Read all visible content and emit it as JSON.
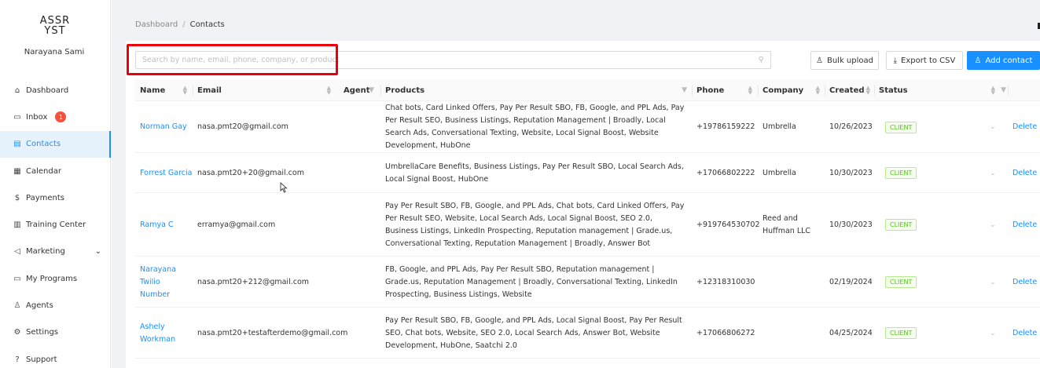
{
  "sidebar": {
    "logo_line1": "ASSR",
    "logo_line2": "YST",
    "user_name": "Narayana Sami",
    "items": [
      {
        "label": "Dashboard",
        "icon": "home-icon",
        "glyph": "⌂"
      },
      {
        "label": "Inbox",
        "icon": "inbox-icon",
        "glyph": "▭",
        "badge": "1"
      },
      {
        "label": "Contacts",
        "icon": "contacts-icon",
        "glyph": "▤"
      },
      {
        "label": "Calendar",
        "icon": "calendar-icon",
        "glyph": "▦"
      },
      {
        "label": "Payments",
        "icon": "dollar-icon",
        "glyph": "$"
      },
      {
        "label": "Training Center",
        "icon": "book-icon",
        "glyph": "▥"
      },
      {
        "label": "Marketing",
        "icon": "megaphone-icon",
        "glyph": "◁",
        "chevron": "⌄"
      },
      {
        "label": "My Programs",
        "icon": "monitor-icon",
        "glyph": "▭"
      },
      {
        "label": "Agents",
        "icon": "users-icon",
        "glyph": "♙"
      },
      {
        "label": "Settings",
        "icon": "gear-icon",
        "glyph": "⚙"
      },
      {
        "label": "Support",
        "icon": "question-icon",
        "glyph": "?"
      }
    ]
  },
  "breadcrumb": {
    "root": "Dashboard",
    "separator": "/",
    "current": "Contacts"
  },
  "search": {
    "placeholder": "Search by name, email, phone, company, or product",
    "value": ""
  },
  "toolbar": {
    "bulk_upload": "Bulk upload",
    "export_csv": "Export to CSV",
    "add_contact": "Add contact"
  },
  "table": {
    "columns": {
      "name": "Name",
      "email": "Email",
      "agent": "Agent",
      "products": "Products",
      "phone": "Phone",
      "company": "Company",
      "created": "Created",
      "status": "Status"
    },
    "rows": [
      {
        "name": "Norman Gay",
        "email": "nasa.pmt20@gmail.com",
        "agent": "",
        "products": "Chat bots, Card Linked Offers, Pay Per Result SBO, FB, Google, and PPL Ads, Pay Per Result SEO, Business Listings, Reputation Management | Broadly, Local Search Ads, Conversational Texting, Website, Local Signal Boost, Website Development, HubOne",
        "phone": "+19786159222",
        "company": "Umbrella",
        "created": "10/26/2023",
        "status": "CLIENT",
        "action": "Delete"
      },
      {
        "name": "Forrest Garcia",
        "email": "nasa.pmt20+20@gmail.com",
        "agent": "",
        "products": "UmbrellaCare Benefits, Business Listings, Pay Per Result SBO, Local Search Ads, Local Signal Boost, HubOne",
        "phone": "+17066802222",
        "company": "Umbrella",
        "created": "10/30/2023",
        "status": "CLIENT",
        "action": "Delete"
      },
      {
        "name": "Ramya C",
        "email": "erramya@gmail.com",
        "agent": "",
        "products": "Pay Per Result SBO, FB, Google, and PPL Ads, Chat bots, Card Linked Offers, Pay Per Result SEO, Website, Local Search Ads, Local Signal Boost, SEO 2.0, Business Listings, LinkedIn Prospecting, Reputation management | Grade.us, Conversational Texting, Reputation Management | Broadly, Answer Bot",
        "phone": "+919764530702",
        "company": "Reed and Huffman LLC",
        "created": "10/30/2023",
        "status": "CLIENT",
        "action": "Delete"
      },
      {
        "name": "Narayana Twilio Number",
        "email": "nasa.pmt20+212@gmail.com",
        "agent": "",
        "products": "FB, Google, and PPL Ads, Pay Per Result SBO, Reputation management | Grade.us, Reputation Management | Broadly, Conversational Texting, LinkedIn Prospecting, Business Listings, Website",
        "phone": "+12318310030",
        "company": "",
        "created": "02/19/2024",
        "status": "CLIENT",
        "action": "Delete"
      },
      {
        "name": "Ashely Workman",
        "email": "nasa.pmt20+testafterdemo@gmail.com",
        "agent": "",
        "products": "Pay Per Result SBO, FB, Google, and PPL Ads, Local Signal Boost, Pay Per Result SEO, Chat bots, Website, SEO 2.0, Local Search Ads, Answer Bot, Website Development, HubOne, Saatchi 2.0",
        "phone": "+17066806272",
        "company": "",
        "created": "04/25/2024",
        "status": "CLIENT",
        "action": "Delete"
      }
    ]
  },
  "colors": {
    "accent": "#1890ff",
    "badge": "#f5503d",
    "highlight": "#e8000b",
    "client_tag": "#52c41a"
  }
}
